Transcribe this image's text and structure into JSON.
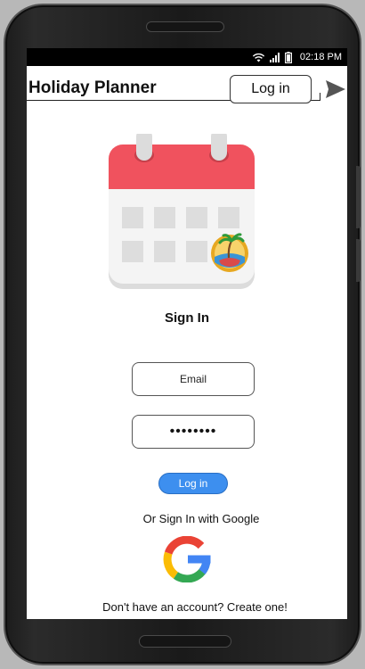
{
  "status_bar": {
    "time": "02:18 PM"
  },
  "header": {
    "title": "Holiday Planner",
    "login_label": "Log in",
    "send_icon": "send-icon"
  },
  "sign_in": {
    "title": "Sign In",
    "email_placeholder": "Email",
    "password_value": "••••••••",
    "login_button_label": "Log in",
    "google_prompt": "Or Sign In with Google",
    "create_account": "Don't have an account? Create one!"
  },
  "colors": {
    "calendar_header": "#f0525e",
    "login_button": "#3d8fef",
    "google_blue": "#4285f4",
    "google_red": "#ea4335",
    "google_yellow": "#fbbc05",
    "google_green": "#34a853"
  }
}
